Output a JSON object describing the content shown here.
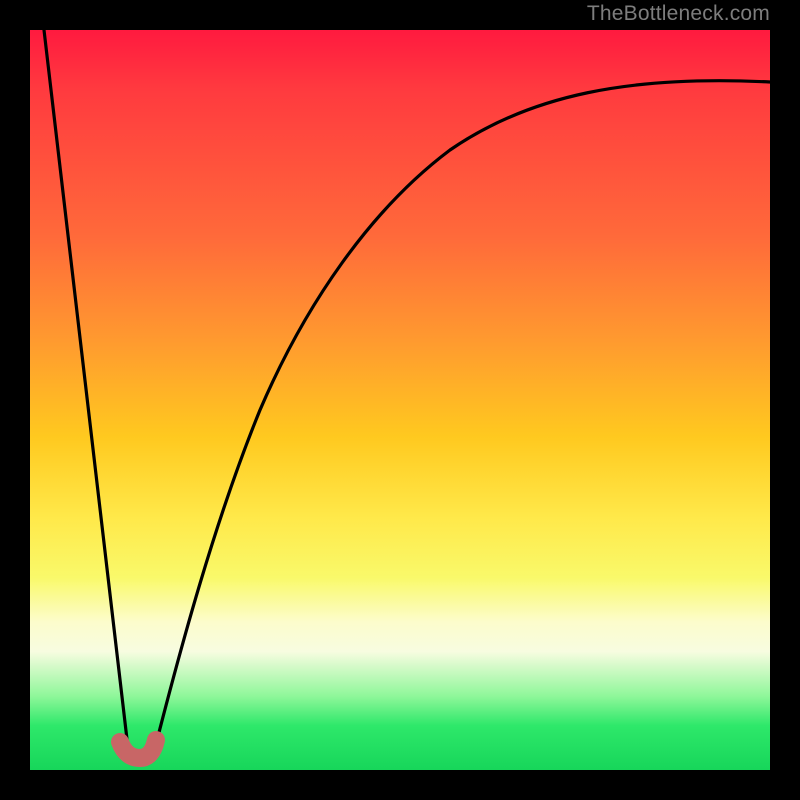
{
  "attribution": "TheBottleneck.com",
  "chart_data": {
    "type": "line",
    "title": "",
    "xlabel": "",
    "ylabel": "",
    "xlim": [
      0,
      100
    ],
    "ylim": [
      0,
      100
    ],
    "grid": false,
    "legend": false,
    "series": [
      {
        "name": "left-descent",
        "x": [
          2,
          13
        ],
        "values": [
          100,
          3
        ]
      },
      {
        "name": "right-ascent",
        "x": [
          17,
          22,
          28,
          35,
          43,
          52,
          62,
          74,
          86,
          100
        ],
        "values": [
          3,
          24,
          42,
          56,
          67,
          76,
          82,
          87,
          90,
          93
        ]
      }
    ],
    "annotations": [
      {
        "name": "bottleneck-hook",
        "x": 15,
        "y": 2
      }
    ]
  }
}
